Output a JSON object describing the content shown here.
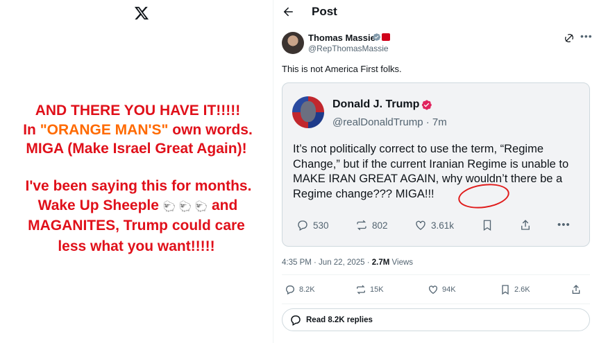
{
  "left_panel": {
    "lines": {
      "l1": "AND THERE YOU HAVE IT!!!!!",
      "l2_pre": "In ",
      "l2_orange": "\"ORANGE MAN'S\"",
      "l2_post": " own words.",
      "l3": "MIGA (Make Israel Great Again)!",
      "l4": "I've been saying this for months.",
      "l5_pre": "Wake Up Sheeple ",
      "l5_emoji": "🐑 🐑 🐑",
      "l5_post": " and",
      "l6": "MAGANITES, Trump could care",
      "l7": "less what you want!!!!!"
    }
  },
  "header": {
    "title": "Post",
    "back_icon": "arrow-left-icon"
  },
  "post": {
    "author_name": "Thomas Massie",
    "author_handle": "@RepThomasMassie",
    "text": "This is not America First folks.",
    "timestamp": "4:35 PM · Jun 22, 2025 · ",
    "views": "2.7M",
    "views_label": " Views",
    "stats": {
      "replies": "8.2K",
      "reposts": "15K",
      "likes": "94K",
      "bookmarks": "2.6K"
    },
    "read_replies": "Read 8.2K replies"
  },
  "quoted": {
    "name": "Donald J. Trump",
    "handle": "@realDonaldTrump · 7m",
    "text_main": "It’s not politically correct to use the term, “Regime Change,” but if the current Iranian Regime is unable to MAKE IRAN GREAT AGAIN, why wouldn’t there be a Regime change??? ",
    "text_highlight": "MIGA!!!",
    "stats": {
      "replies": "530",
      "reposts": "802",
      "likes": "3.61k"
    }
  },
  "colors": {
    "red_text": "#e0101a",
    "orange_text": "#ff6a00",
    "verified_blue": "#1d9bf0",
    "verified_pink": "#e0245e",
    "circle_red": "#e01b1b"
  }
}
